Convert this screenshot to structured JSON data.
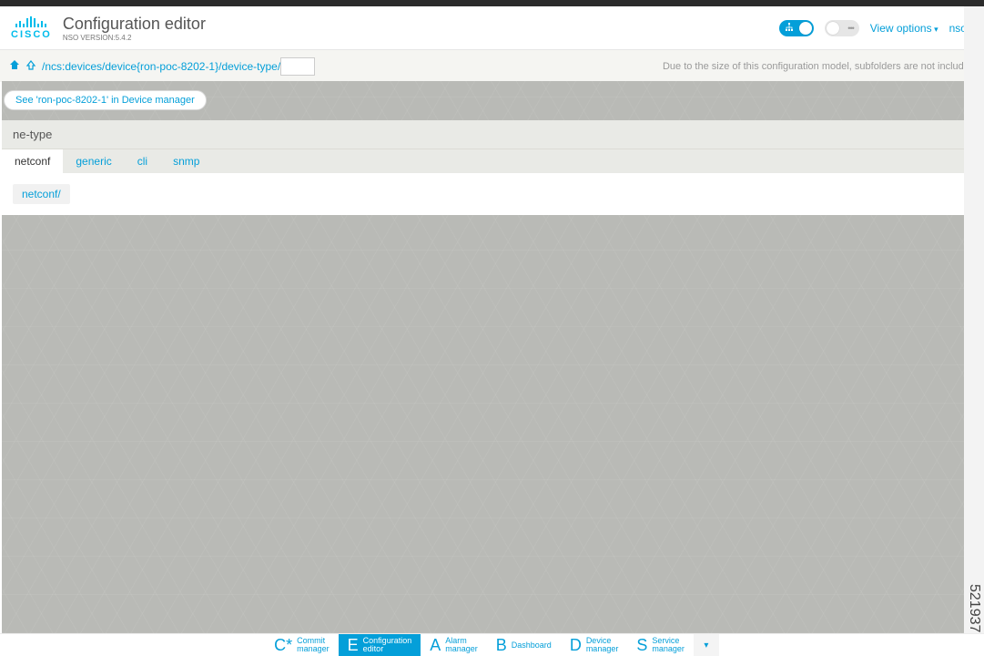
{
  "header": {
    "logo_text": "CISCO",
    "title": "Configuration editor",
    "subtitle": "NSO VERSION:5.4.2",
    "view_options_label": "View options",
    "user_label": "nso"
  },
  "breadcrumb": {
    "path": "/ncs:devices/device{ron-poc-8202-1}/device-type/",
    "note": "Due to the size of this configuration model, subfolders are not included"
  },
  "see_link": "See 'ron-poc-8202-1' in Device manager",
  "panel": {
    "title": "ne-type",
    "tabs": [
      "netconf",
      "generic",
      "cli",
      "snmp"
    ],
    "active_tab_index": 0,
    "content_link": "netconf/"
  },
  "bottom_nav": [
    {
      "letter": "C*",
      "label": "Commit",
      "sublabel": "manager",
      "active": false
    },
    {
      "letter": "E",
      "label": "Configuration",
      "sublabel": "editor",
      "active": true
    },
    {
      "letter": "A",
      "label": "Alarm",
      "sublabel": "manager",
      "active": false
    },
    {
      "letter": "B",
      "label": "Dashboard",
      "sublabel": "",
      "active": false
    },
    {
      "letter": "D",
      "label": "Device",
      "sublabel": "manager",
      "active": false
    },
    {
      "letter": "S",
      "label": "Service",
      "sublabel": "manager",
      "active": false
    }
  ],
  "side_number": "521937"
}
